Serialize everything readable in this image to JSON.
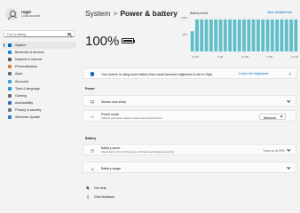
{
  "user": {
    "name": "roger",
    "account": "Local account"
  },
  "search": {
    "placeholder": "Find a setting"
  },
  "nav": [
    {
      "label": "System",
      "color": "#0067c0",
      "active": true
    },
    {
      "label": "Bluetooth & devices",
      "color": "#1a84d6"
    },
    {
      "label": "Network & internet",
      "color": "#4b5a6e"
    },
    {
      "label": "Personalization",
      "color": "#e0783a"
    },
    {
      "label": "Apps",
      "color": "#5b6f86"
    },
    {
      "label": "Accounts",
      "color": "#3aa3e0"
    },
    {
      "label": "Time & language",
      "color": "#2b8fd4"
    },
    {
      "label": "Gaming",
      "color": "#6b6b6b"
    },
    {
      "label": "Accessibility",
      "color": "#2f6fb8"
    },
    {
      "label": "Privacy & security",
      "color": "#6a7684"
    },
    {
      "label": "Windows Update",
      "color": "#1f7ed0"
    }
  ],
  "header": {
    "root": "System",
    "separator": ">",
    "leaf": "Power & battery"
  },
  "battery": {
    "percent_text": "100%"
  },
  "battery_levels": {
    "title": "Battery levels",
    "link": "View detailed info",
    "y_ticks": [
      "100%",
      "50%"
    ],
    "x_ticks": [
      "12 AM",
      "6 AM",
      "12 PM",
      "6 PM",
      "12 AM"
    ],
    "levels": [
      60,
      95,
      95,
      95,
      95,
      95,
      95,
      95,
      95,
      95,
      95,
      95,
      95,
      95,
      95,
      95,
      95,
      95,
      95,
      95,
      95,
      95,
      95
    ]
  },
  "info_card": {
    "text": "Your screen is using more battery than usual because brightness is set to High.",
    "link": "Lower the brightness",
    "close": "×"
  },
  "power_section": {
    "label": "Power",
    "screen_sleep": {
      "title": "Screen and sleep"
    },
    "power_mode": {
      "title": "Power mode",
      "subtitle": "Optimize your device based on power use and performance",
      "value": "Balanced"
    }
  },
  "battery_section": {
    "label": "Battery",
    "battery_saver": {
      "title": "Battery saver",
      "subtitle": "Extend battery life by limiting some notifications and background activity",
      "status": "Turns on at 20%"
    },
    "battery_usage": {
      "title": "Battery usage"
    }
  },
  "footer": {
    "help": "Get help",
    "feedback": "Give feedback"
  },
  "colors": {
    "accent": "#0067c0",
    "bar": "#5fbec8"
  }
}
